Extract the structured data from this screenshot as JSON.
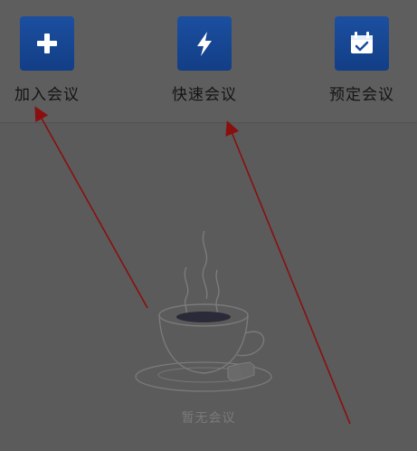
{
  "actions": [
    {
      "label": "加入会议",
      "icon": "plus-icon"
    },
    {
      "label": "快速会议",
      "icon": "lightning-icon"
    },
    {
      "label": "预定会议",
      "icon": "calendar-check-icon"
    }
  ],
  "empty_state": {
    "text": "暂无会议",
    "illustration": "coffee-cup-icon"
  },
  "colors": {
    "overlay_bg": "#5b5b5b",
    "icon_tile": "#1a4a9a",
    "annotation_arrow": "#8a1010"
  }
}
